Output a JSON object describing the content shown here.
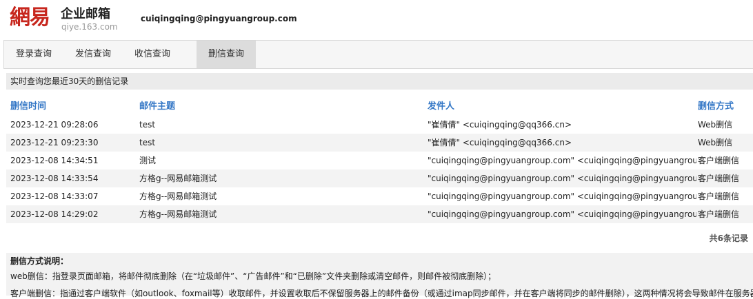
{
  "header": {
    "logo_mark": "網易",
    "logo_title": "企业邮箱",
    "logo_sub": "qiye.163.com",
    "user_email": "cuiqingqing@pingyuangroup.com"
  },
  "tabs": [
    {
      "label": "登录查询",
      "active": false
    },
    {
      "label": "发信查询",
      "active": false
    },
    {
      "label": "收信查询",
      "active": false
    },
    {
      "label": "删信查询",
      "active": true
    }
  ],
  "info_bar": "实时查询您最近30天的删信记录",
  "table": {
    "headers": [
      "删信时间",
      "邮件主题",
      "发件人",
      "删信方式"
    ],
    "rows": [
      [
        "2023-12-21 09:28:06",
        "test",
        "\"崔倩倩\" <cuiqingqing@qq366.cn>",
        "Web删信"
      ],
      [
        "2023-12-21 09:23:30",
        "test",
        "\"崔倩倩\" <cuiqingqing@qq366.cn>",
        "Web删信"
      ],
      [
        "2023-12-08 14:34:51",
        "测试",
        "\"cuiqingqing@pingyuangroup.com\" <cuiqingqing@pingyuangroup.com>",
        "客户端删信"
      ],
      [
        "2023-12-08 14:33:54",
        "方格g--网易邮箱测试",
        "\"cuiqingqing@pingyuangroup.com\" <cuiqingqing@pingyuangroup.com>",
        "客户端删信"
      ],
      [
        "2023-12-08 14:33:07",
        "方格g--网易邮箱测试",
        "\"cuiqingqing@pingyuangroup.com\" <cuiqingqing@pingyuangroup.com>",
        "客户端删信"
      ],
      [
        "2023-12-08 14:29:02",
        "方格g--网易邮箱测试",
        "\"cuiqingqing@pingyuangroup.com\" <cuiqingqing@pingyuangroup.com>",
        "客户端删信"
      ]
    ]
  },
  "total": "共6条记录",
  "explain": {
    "title": "删信方式说明：",
    "lines": [
      "web删信：指登录页面邮箱，将邮件彻底删除（在“垃圾邮件”、“广告邮件”和“已删除”文件夹删除或清空邮件，则邮件被彻底删除）；",
      "客户端删信：指通过客户端软件（如outlook、foxmail等）收取邮件，并设置收取后不保留服务器上的邮件备份（或通过imap同步邮件，并在客户端将同步的邮件删除），这两种情况将会导致邮件在服务器"
    ]
  }
}
